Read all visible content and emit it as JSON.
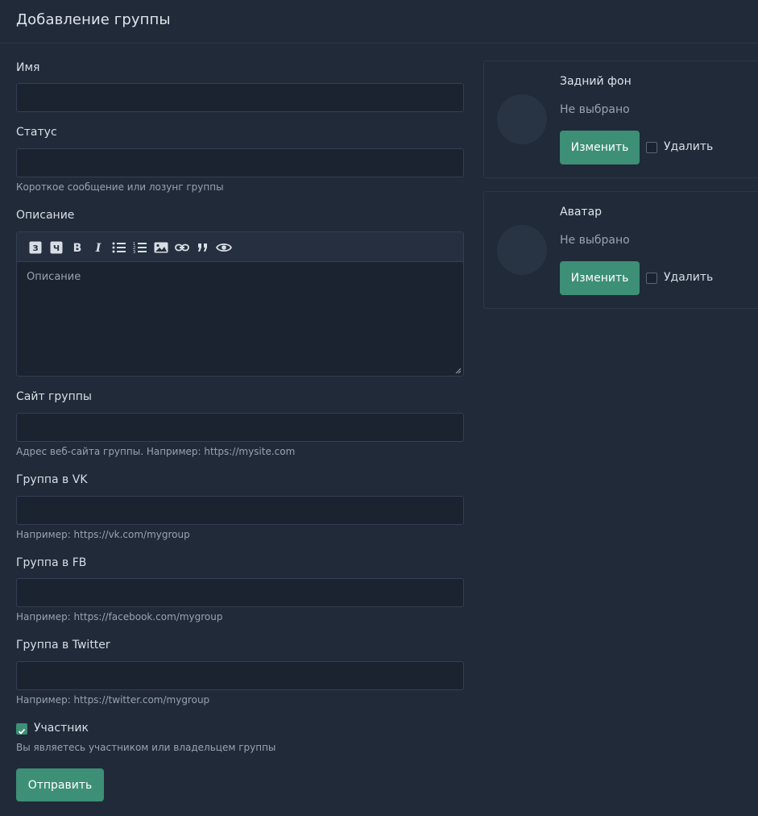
{
  "page": {
    "title": "Добавление группы"
  },
  "form": {
    "name": {
      "label": "Имя",
      "value": ""
    },
    "status": {
      "label": "Статус",
      "value": "",
      "help": "Короткое сообщение или лозунг группы"
    },
    "description": {
      "label": "Описание",
      "placeholder": "Описание",
      "toolbar": [
        "heading-3",
        "heading-4",
        "bold",
        "italic",
        "unordered-list",
        "ordered-list",
        "image",
        "link",
        "quote",
        "preview"
      ]
    },
    "site": {
      "label": "Сайт группы",
      "value": "",
      "help": "Адрес веб-сайта группы. Например: https://mysite.com"
    },
    "vk": {
      "label": "Группа в VK",
      "value": "",
      "help": "Например: https://vk.com/mygroup"
    },
    "fb": {
      "label": "Группа в FB",
      "value": "",
      "help": "Например: https://facebook.com/mygroup"
    },
    "twitter": {
      "label": "Группа в Twitter",
      "value": "",
      "help": "Например: https://twitter.com/mygroup"
    },
    "member": {
      "label": "Участник",
      "checked": true,
      "help": "Вы являетесь участником или владельцем группы"
    },
    "submit_label": "Отправить"
  },
  "background": {
    "title": "Задний фон",
    "status": "Не выбрано",
    "change_label": "Изменить",
    "delete_label": "Удалить",
    "delete_checked": false
  },
  "avatar": {
    "title": "Аватар",
    "status": "Не выбрано",
    "change_label": "Изменить",
    "delete_label": "Удалить",
    "delete_checked": false
  },
  "colors": {
    "accent": "#3d8f76",
    "background": "#212a39",
    "input_bg": "#1c2330",
    "border": "#343f52"
  }
}
